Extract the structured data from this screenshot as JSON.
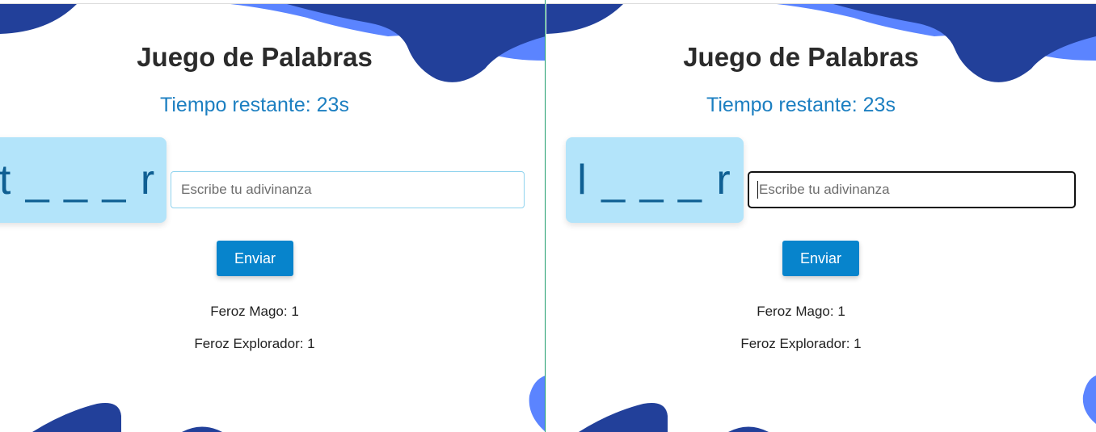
{
  "panes": [
    {
      "title": "Juego de Palabras",
      "timer_text": "Tiempo restante: 23s",
      "hidden_word": "t _ _ _ r",
      "input_placeholder": "Escribe tu adivinanza",
      "input_value": "",
      "input_focused": false,
      "send_label": "Enviar",
      "scores": [
        "Feroz Mago: 1",
        "Feroz Explorador: 1"
      ]
    },
    {
      "title": "Juego de Palabras",
      "timer_text": "Tiempo restante: 23s",
      "hidden_word": "l _ _ _ r",
      "input_placeholder": "Escribe tu adivinanza",
      "input_value": "",
      "input_focused": true,
      "send_label": "Enviar",
      "scores": [
        "Feroz Mago: 1",
        "Feroz Explorador: 1"
      ]
    }
  ],
  "colors": {
    "blob_dark": "#22409a",
    "blob_light": "#5b84ff",
    "timer": "#1c7fc1",
    "word_card": "#b3e4fa",
    "button": "#0784cc",
    "divider": "#1f9e6e"
  }
}
